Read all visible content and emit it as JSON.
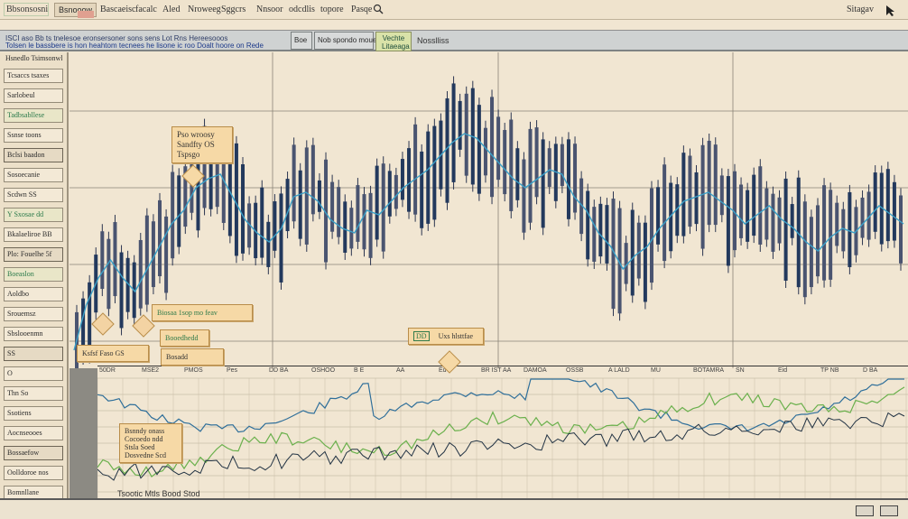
{
  "menubar": {
    "logo": "Bbsonsosnim.clo",
    "tab1": "Bsnooow",
    "items": [
      "Bascaeisc",
      "facalc",
      "Aled",
      "Nroweeg",
      "Sggcrs",
      "Nnsoor",
      "odcdlis",
      "topore",
      "Pasqe"
    ],
    "right": "Sitagav"
  },
  "toolbar": {
    "row1": "ISCI aso Bb ts tnelesoe eronsersoner sons sens Lot Rns Hereesooos",
    "row2": "Tolsen le bassbere is hon heahtom tecnees he lisone ic roo Doalt hoore on Rede",
    "box1": "Boe",
    "box2": "Nob spondo mouebt",
    "green_line1": "Vechte",
    "green_line2": "Litaeaga",
    "right_label": "Nosslliss"
  },
  "leftpanel": {
    "header": "Hsnedlo Tsimsonwl",
    "items": [
      "Tcsaccs tsaxes",
      "Sarlobeul",
      "Tadbsabllese",
      "Ssnse toons",
      "Bclsi baadon",
      "Sosoecanie",
      "Scdwn  SS",
      "Y Sxosae  dd",
      "Bkalaeliroe  BB",
      "Plo: Fouelhe  5f",
      "Boeaslon",
      "Aoldbo",
      "Srouemsz",
      "Sbslooenmn",
      "SS",
      "O",
      "Thn  So",
      "Ssotiens",
      "Aocnseooes",
      "Bossaefow",
      "Oolldoroe nos",
      "Bomnllane"
    ]
  },
  "callouts": {
    "c1": "Pso wroosy\nSandfty  OS\nTspsgo",
    "c2": "Biosaa  1sop mo  feav",
    "c3": "Booedhedd",
    "c4": "Ksfsf  Faso  GS",
    "c5": "Bosadd",
    "c6_badge": "DD",
    "c6": "Uxs hlsttfae",
    "c7": "Bsnndy  onass\nCocoedo ndd\nStsla  Soed\nDosvedne  Scd"
  },
  "indicator": {
    "header_labels": [
      "50DR",
      "MSE2",
      "PMOS",
      "Pes",
      "DD BA",
      "OSHOO",
      "B E",
      "AA",
      "Ed",
      "BR IST AA",
      "DAMOA",
      "OSSB",
      "A LALD",
      "MU",
      "BOTAMRA",
      "SN",
      "Eid",
      "TP NB",
      "D BA"
    ],
    "bottom_label": "Tsootic  Mtls   Bood  Stod"
  },
  "colors": {
    "background": "#f1e6d2",
    "candle_dark": "#2b3550",
    "candle_navy": "#23395d",
    "ma_line": "#3aa0c8",
    "accent_green": "#6ab04c",
    "callout": "#f6d9a6"
  },
  "chart_data": {
    "type": "line",
    "title": "",
    "series": [
      {
        "values": [
          330,
          280,
          250,
          230,
          250,
          265,
          240,
          215,
          190,
          175,
          150,
          140,
          135,
          160,
          185,
          200,
          210,
          195,
          160,
          155,
          165,
          185,
          195,
          200,
          175,
          180,
          165,
          150,
          140,
          130,
          115,
          100,
          90,
          95,
          110,
          125,
          140,
          150,
          140,
          130,
          135,
          160,
          175,
          200,
          215,
          240,
          225,
          215,
          195,
          180,
          165,
          160,
          155,
          165,
          175,
          190,
          180,
          170,
          185,
          195,
          210,
          220,
          205,
          195,
          200,
          185,
          170,
          180,
          190
        ]
      }
    ]
  }
}
